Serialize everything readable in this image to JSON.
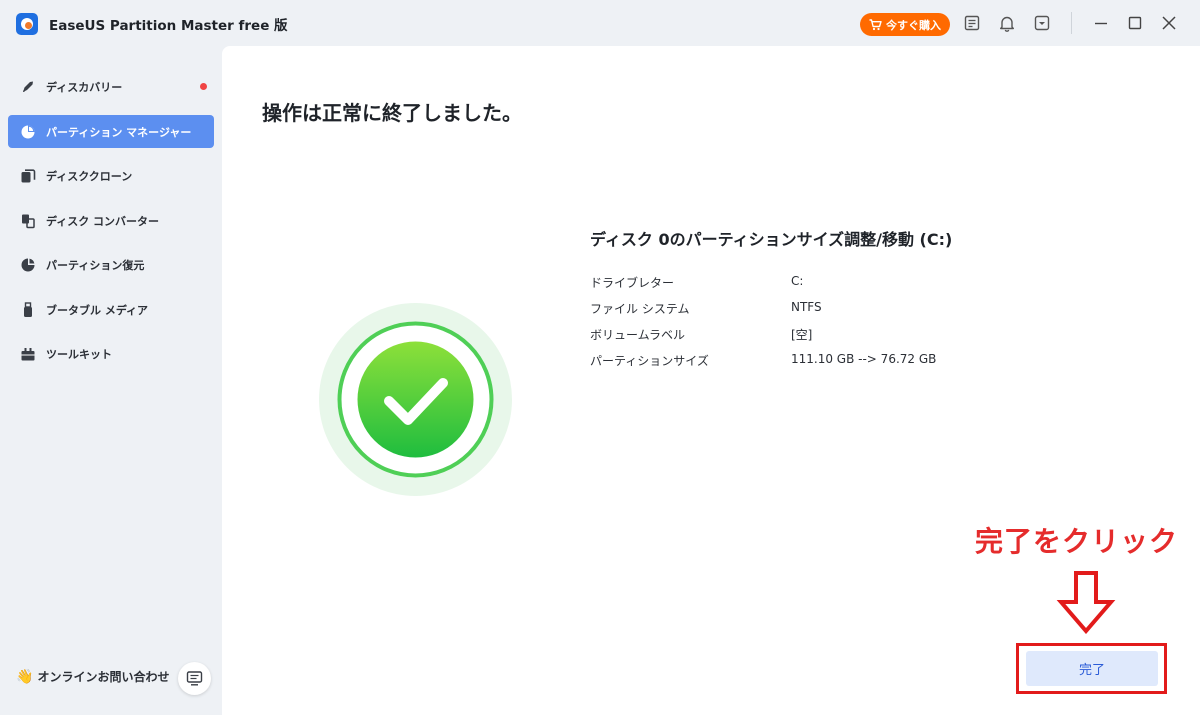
{
  "window": {
    "title": "EaseUS Partition Master free 版",
    "buy_label": "今すぐ購入",
    "icons": [
      "cart-icon",
      "notes-icon",
      "bell-icon",
      "dropdown-icon",
      "minimize-icon",
      "maximize-icon",
      "close-icon"
    ]
  },
  "sidebar": {
    "items": [
      {
        "label": "ディスカバリー",
        "icon": "rocket-icon",
        "has_badge": true
      },
      {
        "label": "パーティション マネージャー",
        "icon": "pie-chart-icon",
        "active": true
      },
      {
        "label": "ディスククローン",
        "icon": "clone-icon"
      },
      {
        "label": "ディスク コンバーター",
        "icon": "convert-icon"
      },
      {
        "label": "パーティション復元",
        "icon": "recover-icon"
      },
      {
        "label": "ブータブル メディア",
        "icon": "usb-icon"
      },
      {
        "label": "ツールキット",
        "icon": "toolkit-icon"
      }
    ],
    "support_label": "オンラインお問い合わせ"
  },
  "main": {
    "heading": "操作は正常に終了しました。",
    "operation_title": "ディスク 0のパーティションサイズ調整/移動 (C:)",
    "details": [
      {
        "key": "ドライブレター",
        "value": "C:"
      },
      {
        "key": "ファイル システム",
        "value": "NTFS"
      },
      {
        "key": "ボリュームラベル",
        "value": "[空]"
      },
      {
        "key": "パーティションサイズ",
        "value": "111.10 GB --> 76.72 GB"
      }
    ],
    "annotation": "完了をクリック",
    "done_label": "完了"
  },
  "colors": {
    "accent": "#5c8ff0",
    "buy": "#ff6a00",
    "success": "#2fc43d",
    "annotation": "#e52c2c"
  }
}
